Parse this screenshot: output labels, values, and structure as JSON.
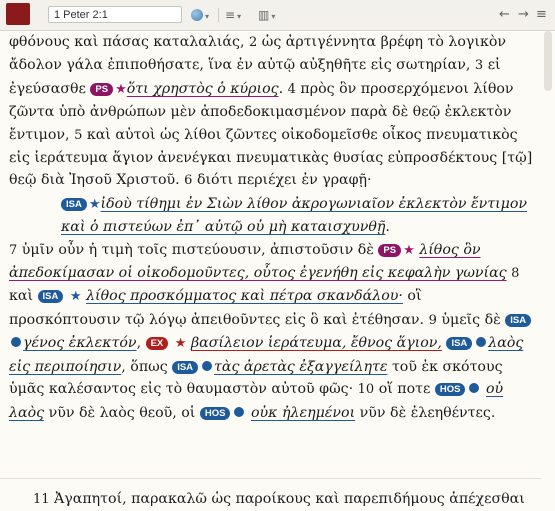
{
  "toolbar": {
    "reference": "1 Peter 2:1",
    "globe_icon": "globe-icon",
    "lines_icon": "lines-icon",
    "columns_icon": "columns-icon",
    "chevron": "▾",
    "back": "←",
    "forward": "→",
    "lines_glyph": "≡",
    "columns_glyph": "▥"
  },
  "colors": {
    "brand": "#8b1a1a",
    "ps": "#8e1466",
    "isa": "#1f5a9a",
    "ex": "#b01e1e"
  },
  "passage": {
    "l1": "φθόνους καὶ πάσας καταλαλιάς, ",
    "v2": "2",
    "l1b": " ὡς ἀρτιγέννητα βρέφη τὸ λογικὸν ἄδολον γάλα ἐπιποθήσατε, ἵνα ἐν αὐτῷ αὐξηθῆτε εἰς σωτηρίαν, ",
    "v3": "3",
    "l1c": " εἰ ἐγεύσασθε ",
    "tag_ps1": "PS",
    "q_ps1": "ὅτι χρηστὸς ὁ κύριος",
    "p1": ". ",
    "v4": "4",
    "l2": " πρὸς ὃν προσερχόμενοι λίθον ζῶντα ὑπὸ ἀνθρώπων μὲν ἀποδεδοκιμασμένον παρὰ δὲ θεῷ ἐκλεκτὸν ἔντιμον, ",
    "v5": "5",
    "l3": " καὶ αὐτοὶ ὡς λίθοι ζῶντες οἰκοδομεῖσθε οἶκος πνευματικὸς εἰς ἱεράτευμα ἅγιον ἀνενέγκαι πνευματικὰς θυσίας εὐπροσδέκτους [τῷ] θεῷ διὰ Ἰησοῦ Χριστοῦ. ",
    "v6": "6",
    "l4": " διότι περιέχει ἐν γραφῇ·",
    "tag_isa1": "ISA",
    "q_isa1": "ἰδοὺ τίθημι ἐν Σιὼν λίθον ἀκρογωνιαῖον ἐκλεκτὸν ἔντιμον καὶ ὁ πιστεύων ἐπ᾽ αὐτῷ οὐ μὴ καταισχυνθῇ",
    "p2": ".",
    "v7": "7",
    "l5": " ὑμῖν οὖν ἡ τιμὴ τοῖς πιστεύουσιν, ἀπιστοῦσιν δὲ ",
    "tag_ps2": "PS",
    "q_ps2": "λίθος ὃν ἀπεδοκίμασαν οἱ οἰκοδομοῦντες, οὗτος ἐγενήθη εἰς κεφαλὴν γωνίας",
    "v8": "8",
    "l6": " καὶ ",
    "tag_isa2": "ISA",
    "q_isa2": "λίθος προσκόμματος καὶ πέτρα σκανδάλου·",
    "l7": " οἳ προσκόπτουσιν τῷ λόγῳ ἀπειθοῦντες εἰς ὃ καὶ ἐτέθησαν. ",
    "v9": "9",
    "l8": " ὑμεῖς δὲ ",
    "tag_isa3": "ISA",
    "q_isa3": "γένος ἐκλεκτόν",
    "p3": ", ",
    "tag_ex": "EX",
    "q_ex": "βασίλειον ἱεράτευμα, ἔθνος ἅγιον,",
    "tag_isa4": "ISA",
    "q_isa4": "λαὸς εἰς περιποίησιν",
    "l9": ", ὅπως ",
    "tag_isa5": "ISA",
    "q_isa5": "τὰς ἀρετὰς ἐξαγγείλητε",
    "l10": " τοῦ ἐκ σκότους ὑμᾶς καλέσαντος εἰς τὸ θαυμαστὸν αὐτοῦ φῶς· ",
    "v10": "10",
    "l11": " οἵ ποτε ",
    "tag_hos1": "HOS",
    "q_hos1": "οὐ λαὸς",
    "l12": " νῦν δὲ λαὸς θεοῦ, οἱ ",
    "tag_hos2": "HOS",
    "q_hos2": "οὐκ ἠλεημένοι",
    "l13": " νῦν δὲ ἐλεηθέντες.",
    "v11": "11",
    "l14": " Ἀγαπητοί, παρακαλῶ ὡς παροίκους καὶ παρεπιδήμους ἀπέχεσθαι"
  }
}
